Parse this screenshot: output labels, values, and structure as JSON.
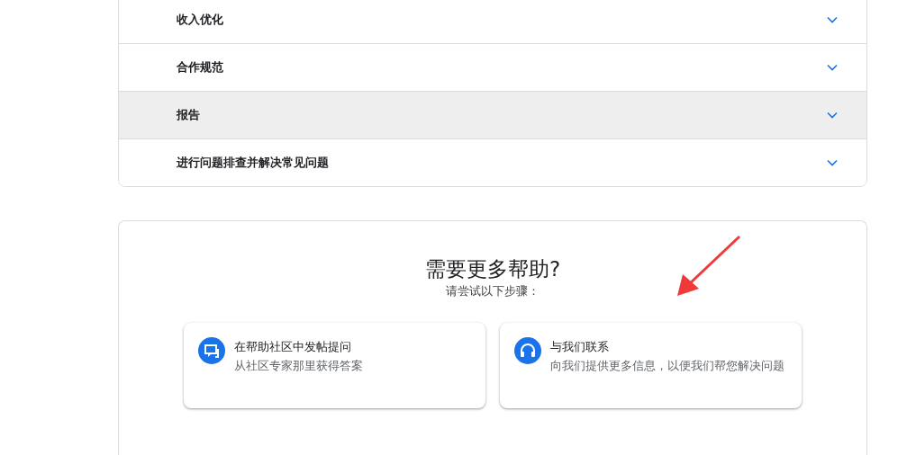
{
  "topics": [
    {
      "label": "收入优化",
      "hovered": false
    },
    {
      "label": "合作规范",
      "hovered": false
    },
    {
      "label": "报告",
      "hovered": true
    },
    {
      "label": "进行问题排查并解决常见问题",
      "hovered": false
    }
  ],
  "help": {
    "title": "需要更多帮助?",
    "subtitle": "请尝试以下步骤：",
    "options": [
      {
        "kind": "community",
        "title": "在帮助社区中发帖提问",
        "description": "从社区专家那里获得答案"
      },
      {
        "kind": "contact",
        "title": "与我们联系",
        "description": "向我们提供更多信息，以便我们帮您解决问题"
      }
    ]
  }
}
